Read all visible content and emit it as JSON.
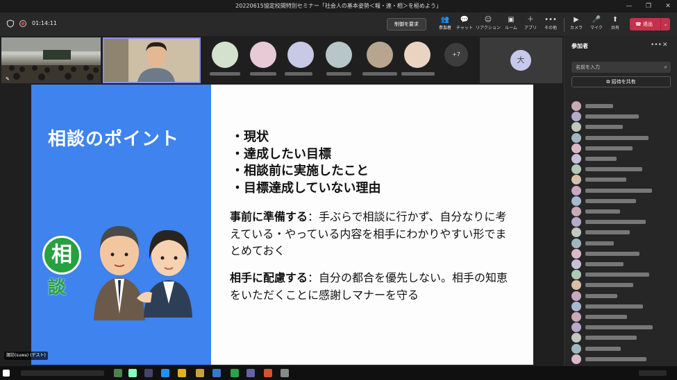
{
  "window": {
    "title": "20220615協定校間特別セミナー「社会人の基本姿勢＜報・連・相＞を極めよう」",
    "minimize": "—",
    "restore": "❐",
    "close": "✕"
  },
  "meeting": {
    "timer": "01:14:11",
    "request_control": "制御を要求",
    "tools": [
      {
        "icon": "👥",
        "label": "参加者"
      },
      {
        "icon": "💬",
        "label": "チャット"
      },
      {
        "icon": "☺",
        "label": "リアクション"
      },
      {
        "icon": "▣",
        "label": "ルーム"
      },
      {
        "icon": "＋",
        "label": "アプリ"
      },
      {
        "icon": "•••",
        "label": "その他"
      },
      {
        "icon": "▶",
        "label": "カメラ"
      },
      {
        "icon": "🎤",
        "label": "マイク"
      },
      {
        "icon": "⬆",
        "label": "共有"
      }
    ],
    "leave": "退出",
    "leave_chevron": "⌄"
  },
  "strip": {
    "more_count": "+7",
    "dai_initial": "大"
  },
  "slide": {
    "title": "相談のポイント",
    "so": "相",
    "dan": "談",
    "bullets": [
      "・現状",
      "・達成したい目標",
      "・相談前に実施したこと",
      "・目標達成していない理由"
    ],
    "para1_bold": "事前に準備する",
    "para1_rest": "：手ぶらで相談に行かず、自分なりに考えている・やっている内容を相手にわかりやすい形でまとめておく",
    "para2_bold": "相手に配慮する",
    "para2_rest": "：自分の都合を優先しない。相手の知恵をいただくことに感謝しマナーを守る"
  },
  "presenter_tag": "諏訪(suwa) (ゲスト)",
  "panel": {
    "title": "参加者",
    "more": "•••",
    "close": "✕",
    "search_placeholder": "名前を入力",
    "share_invite": "招待を共有"
  }
}
